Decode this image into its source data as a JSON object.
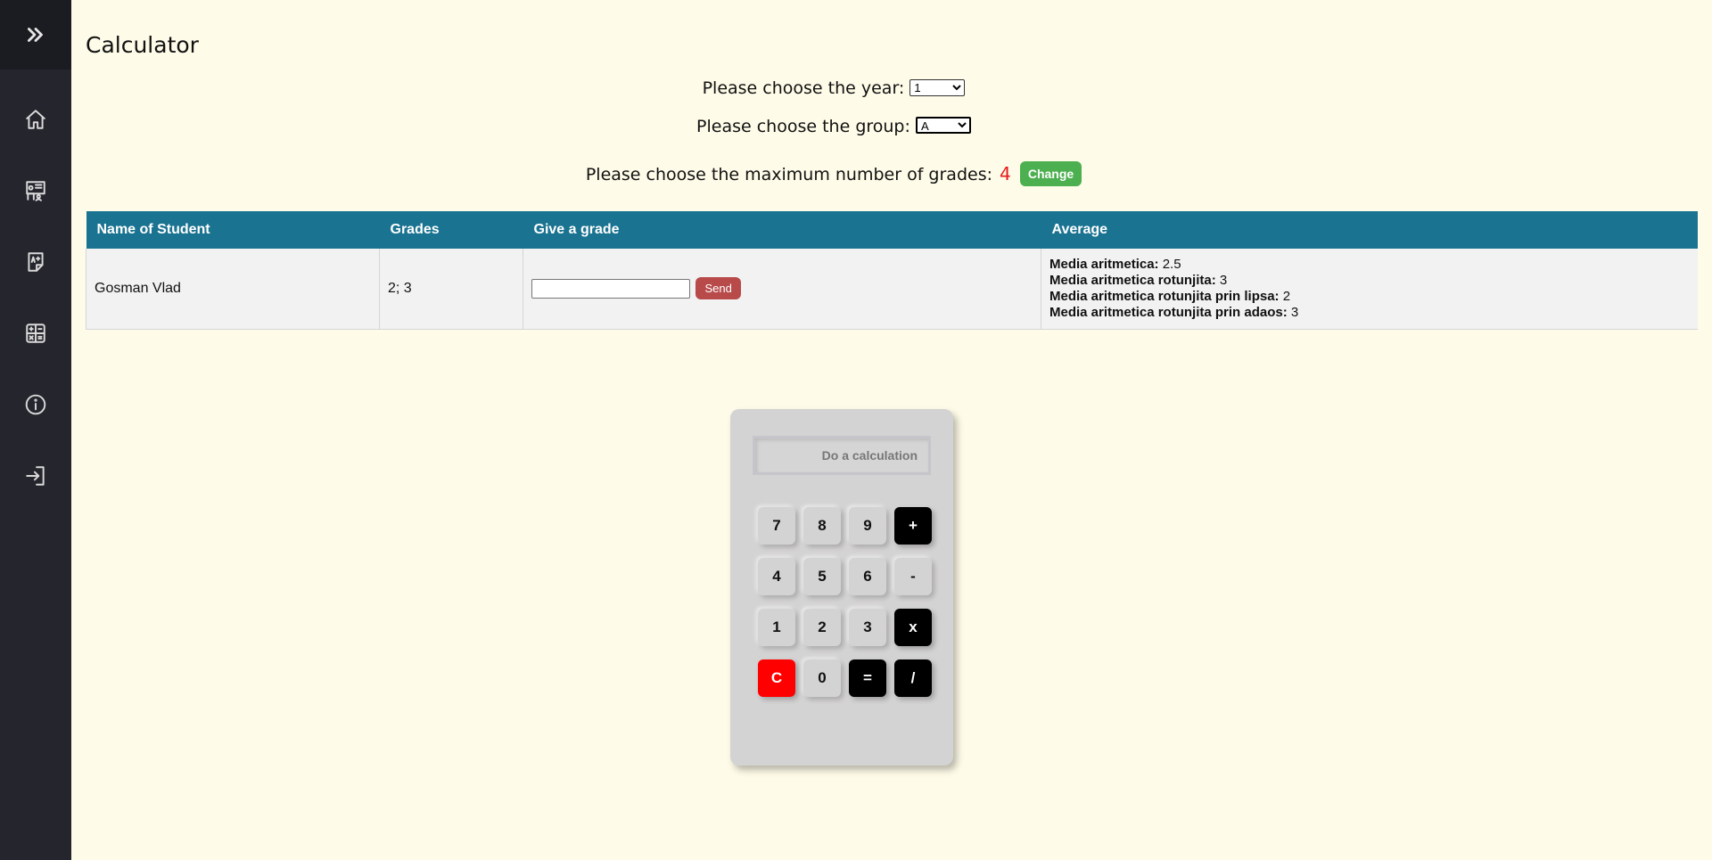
{
  "sidebar": {
    "toggle_icon": "double-chevron-right-icon",
    "items": [
      {
        "id": "home",
        "icon": "home-icon"
      },
      {
        "id": "teacher",
        "icon": "teacher-board-icon"
      },
      {
        "id": "grades",
        "icon": "grade-document-icon"
      },
      {
        "id": "calculator",
        "icon": "calculator-icon"
      },
      {
        "id": "info",
        "icon": "info-icon"
      },
      {
        "id": "logout",
        "icon": "sign-in-icon"
      }
    ]
  },
  "page": {
    "title": "Calculator"
  },
  "form": {
    "year_label": "Please choose the year:",
    "year_value": "1",
    "group_label": "Please choose the group:",
    "group_value": "A",
    "max_grades_label": "Please choose the maximum number of grades:",
    "max_grades_value": "4",
    "change_button": "Change"
  },
  "table": {
    "headers": [
      "Name of Student",
      "Grades",
      "Give a grade",
      "Average"
    ],
    "rows": [
      {
        "name": "Gosman Vlad",
        "grades": "2; 3",
        "input_value": "",
        "send_button": "Send",
        "averages": [
          {
            "label": "Media aritmetica:",
            "value": "2.5"
          },
          {
            "label": "Media aritmetica rotunjita:",
            "value": "3"
          },
          {
            "label": "Media aritmetica rotunjita prin lipsa:",
            "value": "2"
          },
          {
            "label": "Media aritmetica rotunjita prin adaos:",
            "value": "3"
          }
        ]
      }
    ]
  },
  "calculator": {
    "display_placeholder": "Do a calculation",
    "keys": [
      "7",
      "8",
      "9",
      "+",
      "4",
      "5",
      "6",
      "-",
      "1",
      "2",
      "3",
      "x",
      "C",
      "0",
      "=",
      "/"
    ]
  },
  "colors": {
    "background": "#fefbe8",
    "sidebar": "#24252d",
    "table_header": "#1a7391",
    "change_button": "#4caf50",
    "send_button": "#b84a4a",
    "max_value": "#e8191a",
    "clear_key": "#fe0000"
  }
}
